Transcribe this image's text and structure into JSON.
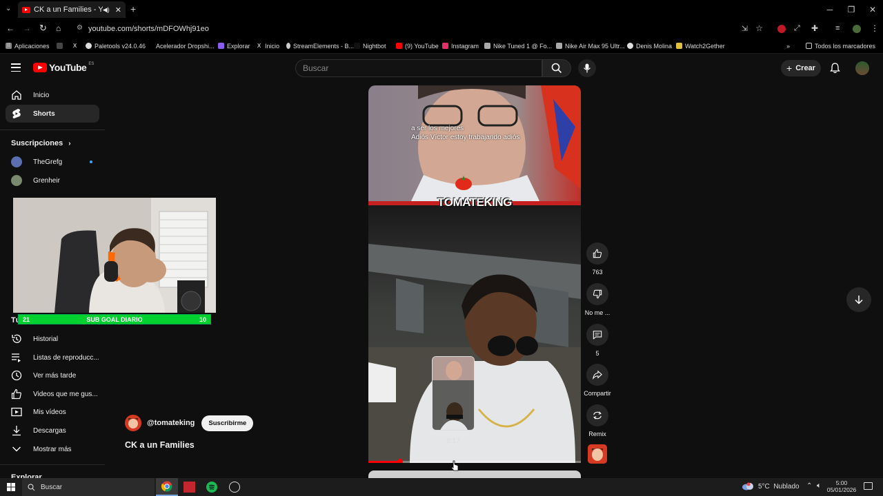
{
  "browser": {
    "tab_title": "CK a un Families - YouTube",
    "url": "youtube.com/shorts/mDFOWhj91eo",
    "bookmarks": [
      "Aplicaciones",
      "Paletools v24.0.46",
      "Acelerador Dropshi...",
      "Explorar",
      "Inicio",
      "StreamElements - B...",
      "Nightbot",
      "(9) YouTube",
      "Instagram",
      "Nike Tuned 1 @ Fo...",
      "Nike Air Max 95 Ultr...",
      "Denis Molina",
      "Watch2Gether"
    ],
    "all_bookmarks": "Todos los marcadores",
    "more_bookmarks": "»"
  },
  "youtube": {
    "logo_text": "YouTube",
    "logo_region": "ES",
    "search_placeholder": "Buscar",
    "create_label": "Crear"
  },
  "sidebar": {
    "nav": [
      {
        "label": "Inicio",
        "icon": "home-icon"
      },
      {
        "label": "Shorts",
        "icon": "shorts-icon"
      }
    ],
    "subs_header": "Suscripciones",
    "subs": [
      {
        "label": "TheGrefg",
        "color": "#5a6fb0"
      },
      {
        "label": "Grenheir",
        "color": "#7a8a70"
      }
    ],
    "you_header": "Tú",
    "you_items": [
      {
        "label": "Historial",
        "icon": "history-icon"
      },
      {
        "label": "Listas de reproducc...",
        "icon": "playlist-icon"
      },
      {
        "label": "Ver más tarde",
        "icon": "clock-icon"
      },
      {
        "label": "Videos que me gus...",
        "icon": "like-icon"
      },
      {
        "label": "Mis vídeos",
        "icon": "video-icon"
      },
      {
        "label": "Descargas",
        "icon": "download-icon"
      },
      {
        "label": "Mostrar más",
        "icon": "chevron-down-icon"
      }
    ],
    "explore_header": "Explorar"
  },
  "overlay": {
    "sub_goal_label": "SUB GOAL DIARIO",
    "sub_goal_current": "21",
    "sub_goal_target": "10"
  },
  "short": {
    "caption_line1": "a ser los mejores",
    "caption_line2": "Adiós Víctor estoy trabajando adiós",
    "brand": "TOMATEKING",
    "channel": "@tomateking",
    "subscribe_label": "Suscribirme",
    "title": "CK a un Families",
    "preview_time": "0:17",
    "progress": 0.15,
    "actions": [
      {
        "label": "763",
        "icon": "like-icon"
      },
      {
        "label": "No me ...",
        "icon": "dislike-icon"
      },
      {
        "label": "5",
        "icon": "comment-icon"
      },
      {
        "label": "Compartir",
        "icon": "share-icon"
      },
      {
        "label": "Remix",
        "icon": "remix-icon"
      }
    ]
  },
  "taskbar": {
    "search_placeholder": "Buscar",
    "weather": "5°C  Nublado",
    "time": "5:00",
    "date": "05/01/2026"
  },
  "colors": {
    "accent": "#ff0000",
    "subgoal": "#00d12e",
    "bg": "#0f0f0f"
  }
}
